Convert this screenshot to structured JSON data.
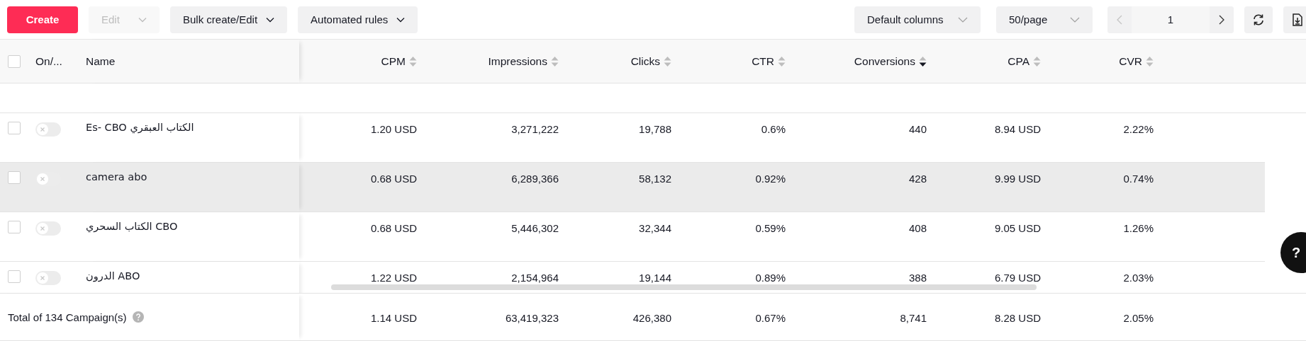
{
  "toolbar": {
    "create": "Create",
    "edit": {
      "label": "Edit",
      "disabled": true
    },
    "bulk": "Bulk create/Edit",
    "rules": "Automated rules",
    "columns_select": "Default columns",
    "page_size": "50/page",
    "pager": {
      "page": "1",
      "prev_disabled": true,
      "next_disabled": false
    }
  },
  "table": {
    "columns": [
      {
        "label": "CPM",
        "sorted_desc": false
      },
      {
        "label": "Impressions",
        "sorted_desc": false
      },
      {
        "label": "Clicks",
        "sorted_desc": false
      },
      {
        "label": "CTR",
        "sorted_desc": false
      },
      {
        "label": "Conversions",
        "sorted_desc": true
      },
      {
        "label": "CPA",
        "sorted_desc": false
      },
      {
        "label": "CVR",
        "sorted_desc": false
      }
    ],
    "fixed_columns": {
      "status": "On/...",
      "name": "Name"
    },
    "header_checked": false,
    "rows": [
      {
        "checked": false,
        "on": false,
        "selected": false,
        "name": "Es- CBO الكتاب العبقري",
        "values": [
          "1.20 USD",
          "3,271,222",
          "19,788",
          "0.6%",
          "440",
          "8.94 USD",
          "2.22%"
        ]
      },
      {
        "checked": false,
        "on": false,
        "selected": true,
        "name": "camera abo",
        "values": [
          "0.68 USD",
          "6,289,366",
          "58,132",
          "0.92%",
          "428",
          "9.99 USD",
          "0.74%"
        ]
      },
      {
        "checked": false,
        "on": false,
        "selected": false,
        "name": "الكتاب السحري CBO",
        "values": [
          "0.68 USD",
          "5,446,302",
          "32,344",
          "0.59%",
          "408",
          "9.05 USD",
          "1.26%"
        ]
      },
      {
        "checked": false,
        "on": false,
        "selected": false,
        "name": "الدرون ABO",
        "values": [
          "1.22 USD",
          "2,154,964",
          "19,144",
          "0.89%",
          "388",
          "6.79 USD",
          "2.03%"
        ]
      }
    ],
    "total": {
      "label": "Total of 134 Campaign(s)",
      "values": [
        "1.14 USD",
        "63,419,323",
        "426,380",
        "0.67%",
        "8,741",
        "8.28 USD",
        "2.05%"
      ]
    }
  },
  "help_button": "?"
}
